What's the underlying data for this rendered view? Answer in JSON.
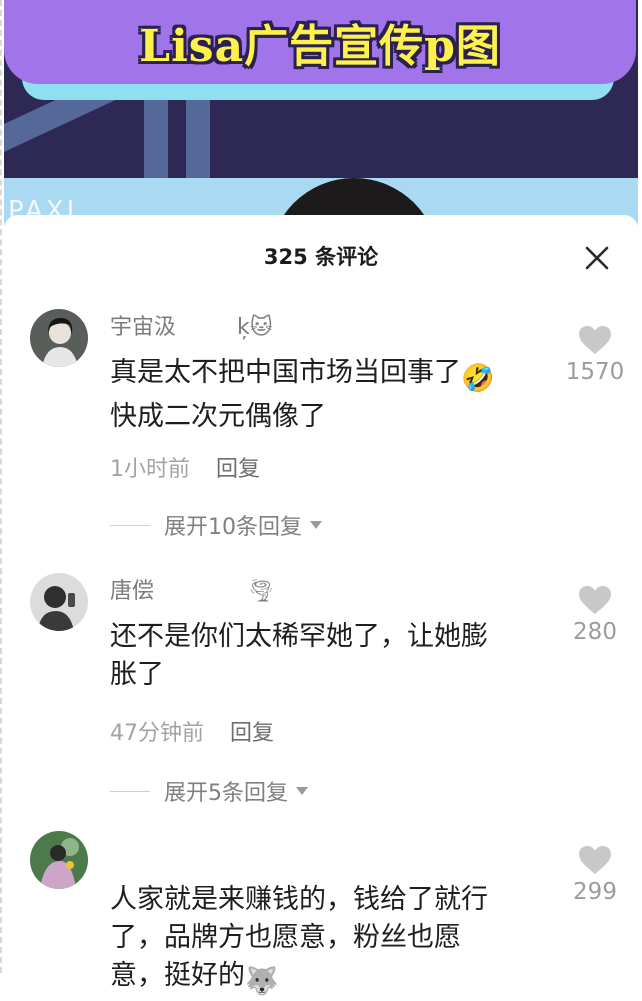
{
  "banner": {
    "title": "Lisa广告宣传p图",
    "logo_text": "PAXL"
  },
  "panel": {
    "title": "325 条评论",
    "close_icon": "close-icon"
  },
  "comments": [
    {
      "username": "宇宙汲",
      "badge": "ķ🐱",
      "content_line1": "真是太不把中国市场当回事了",
      "content_emoji": "🤣",
      "content_line2": "快成二次元偶像了",
      "time": "1小时前",
      "reply": "回复",
      "expand": "展开10条回复",
      "likes": "1570"
    },
    {
      "username": "唐偿",
      "badge": "🌪",
      "content_line1": "还不是你们太稀罕她了，让她膨",
      "content_line2": "胀了",
      "time": "47分钟前",
      "reply": "回复",
      "expand": "展开5条回复",
      "likes": "280"
    },
    {
      "content_line1": "人家就是来赚钱的，钱给了就行",
      "content_line2": "了，品牌方也愿意，粉丝也愿",
      "content_line3": "意，挺好的",
      "content_emoji": "🐺",
      "likes": "299"
    }
  ],
  "colors": {
    "title_band": "#a274ea",
    "title_text": "#fff14c",
    "banner_bg": "#2d2954"
  }
}
